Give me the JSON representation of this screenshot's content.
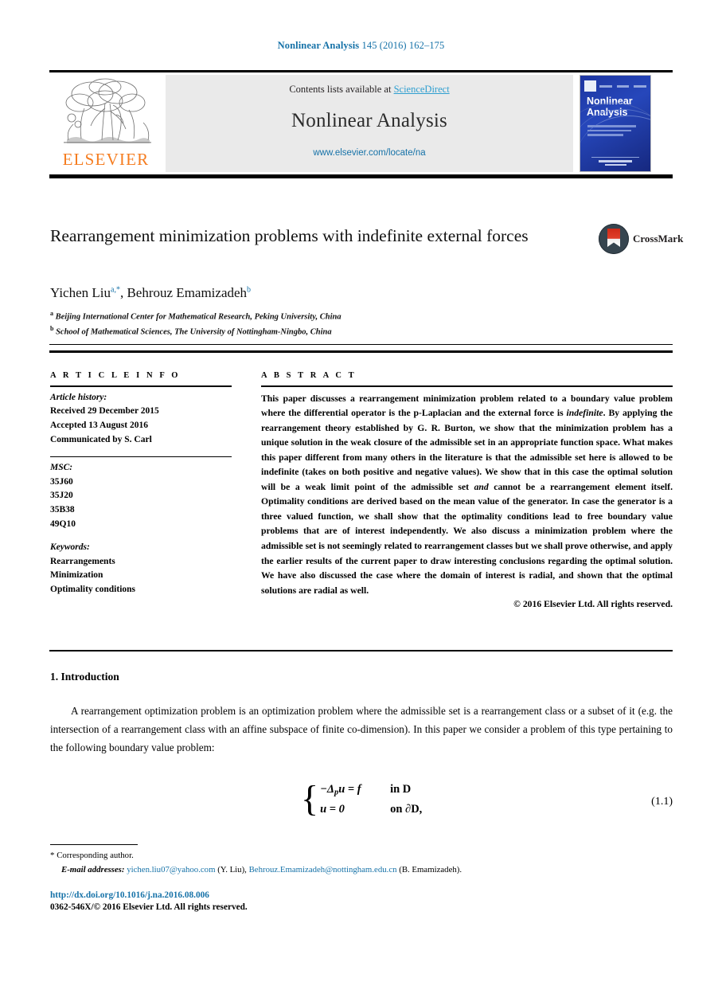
{
  "running_head": {
    "journal": "Nonlinear Analysis",
    "citation": " 145 (2016) 162–175"
  },
  "masthead": {
    "contents_label": "Contents lists available at ",
    "sciencedirect": "ScienceDirect",
    "journal_title": "Nonlinear Analysis",
    "url": "www.elsevier.com/locate/na",
    "publisher_logo_text": "ELSEVIER",
    "cover_title": "Nonlinear Analysis",
    "accent_link_color": "#2f9fd0",
    "elsevier_orange": "#f57c1f"
  },
  "article": {
    "title": "Rearrangement minimization problems with indefinite external forces",
    "crossmark_label": "CrossMark",
    "authors_html": "Yichen Liu<sup>a,*</sup>, Behrouz Emamizadeh<sup>b</sup>",
    "affiliations": [
      {
        "marker": "a",
        "text": "Beijing International Center for Mathematical Research, Peking University, China"
      },
      {
        "marker": "b",
        "text": "School of Mathematical Sciences, The University of Nottingham-Ningbo, China"
      }
    ]
  },
  "article_info": {
    "heading": "A R T I C L E   I N F O",
    "history_label": "Article history:",
    "history": [
      "Received 29 December 2015",
      "Accepted 13 August 2016",
      "Communicated by S. Carl"
    ],
    "msc_label": "MSC:",
    "msc": [
      "35J60",
      "35J20",
      "35B38",
      "49Q10"
    ],
    "keywords_label": "Keywords:",
    "keywords": [
      "Rearrangements",
      "Minimization",
      "Optimality conditions"
    ]
  },
  "abstract": {
    "heading": "A B S T R A C T",
    "paragraph_1": "This paper discusses a rearrangement minimization problem related to a boundary value problem where the differential operator is the p-Laplacian and the external force is ",
    "italic_1": "indefinite",
    "paragraph_2": ". By applying the rearrangement theory established by G. R. Burton, we show that the minimization problem has a unique solution in the weak closure of the admissible set in an appropriate function space. What makes this paper different from many others in the literature is that the admissible set here is allowed to be indefinite (takes on both positive and negative values). We show that in this case the optimal solution will be a weak limit point of the admissible set ",
    "italic_2": "and",
    "paragraph_3": " cannot be a rearrangement element itself. Optimality conditions are derived based on the mean value of the generator. In case the generator is a three valued function, we shall show that the optimality conditions lead to free boundary value problems that are of interest independently. We also discuss a minimization problem where the admissible set is not seemingly related to rearrangement classes but we shall prove otherwise, and apply the earlier results of the current paper to draw interesting conclusions regarding the optimal solution. We have also discussed the case where the domain of interest is radial, and shown that the optimal solutions are radial as well.",
    "copyright": "© 2016 Elsevier Ltd. All rights reserved."
  },
  "body": {
    "section_number_title": "1.  Introduction",
    "paragraph": "A rearrangement optimization problem is an optimization problem where the admissible set is a rearrangement class or a subset of it (e.g. the intersection of a rearrangement class with an affine subspace of finite co-dimension). In this paper we consider a problem of this type pertaining to the following boundary value problem:"
  },
  "equation": {
    "number": "(1.1)",
    "line1_lhs": "−Δ",
    "line1_lhs_sub": "p",
    "line1_lhs_rest": "u = f",
    "line1_rhs": "in D",
    "line2_lhs": "u = 0",
    "line2_rhs": "on ∂D,"
  },
  "footer": {
    "corresponding_star": "*",
    "corresponding_text": "Corresponding author.",
    "email_label": "E-mail addresses:",
    "email_1": "yichen.liu07@yahoo.com",
    "email_1_owner": "(Y. Liu),",
    "email_2": "Behrouz.Emamizadeh@nottingham.edu.cn",
    "email_2_owner": "(B. Emamizadeh).",
    "doi": "http://dx.doi.org/10.1016/j.na.2016.08.006",
    "issn_line": "0362-546X/© 2016 Elsevier Ltd. All rights reserved."
  }
}
